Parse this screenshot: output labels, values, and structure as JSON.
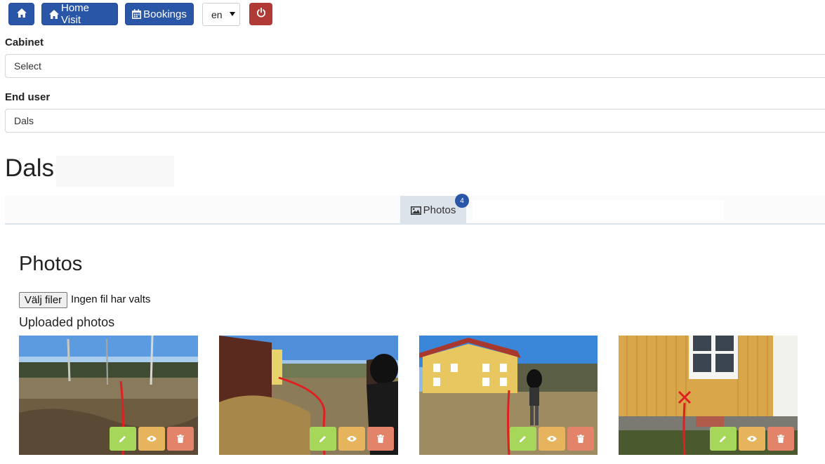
{
  "toolbar": {
    "home_icon": "home-icon",
    "home_visit_label": "Home Visit",
    "bookings_label": "Bookings",
    "language_value": "en",
    "power_icon": "power-icon",
    "primary_color": "#2a56a8",
    "danger_color": "#b03a36"
  },
  "form": {
    "cabinet_label": "Cabinet",
    "cabinet_value": "Select",
    "end_user_label": "End user",
    "end_user_value": "Dals"
  },
  "page": {
    "title": "Dals"
  },
  "tabs": {
    "photos_label": "Photos",
    "photos_badge": "4",
    "photos_icon": "image-icon"
  },
  "photos_section": {
    "title": "Photos",
    "file_button_label": "Välj filer",
    "file_status": "Ingen fil har valts",
    "uploaded_title": "Uploaded photos",
    "items": [
      {
        "scene": "field with trees",
        "actions": [
          "edit",
          "view",
          "delete"
        ]
      },
      {
        "scene": "barn and path",
        "actions": [
          "edit",
          "view",
          "delete"
        ]
      },
      {
        "scene": "yellow house with person",
        "actions": [
          "edit",
          "view",
          "delete"
        ]
      },
      {
        "scene": "yellow wall with window",
        "actions": [
          "edit",
          "view",
          "delete"
        ]
      }
    ],
    "action_colors": {
      "edit": "#a6d65a",
      "view": "#e5b45c",
      "delete": "#e3836a"
    }
  }
}
